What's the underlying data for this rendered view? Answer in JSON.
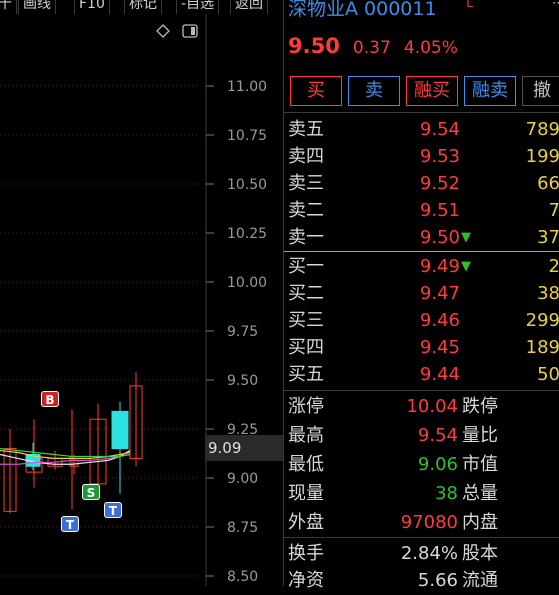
{
  "toolbar": {
    "items": [
      "十",
      "画线",
      "F10",
      "标记",
      "-自选",
      "返回"
    ]
  },
  "chart": {
    "icons": [
      "diamond-icon",
      "panel-toggle-icon"
    ],
    "y_ticks": [
      "11.00",
      "10.75",
      "10.50",
      "10.25",
      "10.00",
      "9.75",
      "9.50",
      "9.25",
      "9.00",
      "8.75",
      "8.50"
    ],
    "current_price_label": "9.09",
    "markers": [
      {
        "label": "B",
        "color": "#d42020"
      },
      {
        "label": "S",
        "color": "#1a9a30"
      },
      {
        "label": "T",
        "color": "#3a6fd8"
      },
      {
        "label": "T",
        "color": "#3a6fd8"
      }
    ],
    "colors": {
      "up": "#ff3b3b",
      "down": "#2ee0e0",
      "ma5": "#e8e8e8",
      "ma10": "#e8d040",
      "ma20": "#d050d0",
      "ma30": "#40d040"
    }
  },
  "chart_data": {
    "type": "candlestick",
    "ylim": [
      8.5,
      11.0
    ],
    "yticks": [
      11.0,
      10.75,
      10.5,
      10.25,
      10.0,
      9.75,
      9.5,
      9.25,
      9.0,
      8.75,
      8.5
    ],
    "candles": [
      {
        "open": 9.15,
        "close": 8.83,
        "high": 9.25,
        "low": 8.82,
        "dir": "up"
      },
      {
        "open": 9.1,
        "close": 9.03,
        "high": 9.3,
        "low": 8.95,
        "dir": "up"
      },
      {
        "open": 9.06,
        "close": 9.12,
        "high": 9.18,
        "low": 9.04,
        "dir": "down"
      },
      {
        "open": 9.1,
        "close": 9.06,
        "high": 9.14,
        "low": 9.04,
        "dir": "up"
      },
      {
        "open": 9.11,
        "close": 9.09,
        "high": 9.35,
        "low": 8.84,
        "dir": "up"
      },
      {
        "open": 9.06,
        "close": 9.09,
        "high": 9.12,
        "low": 9.02,
        "dir": "up"
      },
      {
        "open": 9.3,
        "close": 8.97,
        "high": 9.38,
        "low": 8.95,
        "dir": "up"
      },
      {
        "open": 9.15,
        "close": 9.34,
        "high": 9.39,
        "low": 8.92,
        "dir": "down"
      },
      {
        "open": 9.47,
        "close": 9.1,
        "high": 9.54,
        "low": 9.06,
        "dir": "up"
      }
    ],
    "ma_lines": {
      "ma5": [
        9.12,
        9.1,
        9.08,
        9.07,
        9.07,
        9.08,
        9.09,
        9.11,
        9.14
      ],
      "ma10": [
        9.14,
        9.13,
        9.11,
        9.1,
        9.1,
        9.1,
        9.11,
        9.12,
        9.13
      ],
      "ma20": [
        9.07,
        9.07,
        9.08,
        9.08,
        9.09,
        9.09,
        9.1,
        9.11,
        9.12
      ],
      "ma30": [
        9.15,
        9.14,
        9.13,
        9.12,
        9.11,
        9.11,
        9.11,
        9.11,
        9.12
      ]
    }
  },
  "stock": {
    "name": "深物业A",
    "code": "000011",
    "flag": "L",
    "price": "9.50",
    "change": "0.37",
    "change_pct": "4.05%"
  },
  "trade_buttons": [
    {
      "label": "买",
      "color": "#ff3b3b"
    },
    {
      "label": "卖",
      "color": "#3d8ee8"
    },
    {
      "label": "融买",
      "color": "#ff3b3b"
    },
    {
      "label": "融卖",
      "color": "#3d8ee8"
    },
    {
      "label": "撤",
      "color": "#c0c0c0"
    }
  ],
  "order_book": {
    "sell": [
      {
        "label": "卖五",
        "price": "9.54",
        "vol": "789"
      },
      {
        "label": "卖四",
        "price": "9.53",
        "vol": "199"
      },
      {
        "label": "卖三",
        "price": "9.52",
        "vol": "66"
      },
      {
        "label": "卖二",
        "price": "9.51",
        "vol": "7"
      },
      {
        "label": "卖一",
        "price": "9.50",
        "vol": "37",
        "arrow": "🡣"
      }
    ],
    "buy": [
      {
        "label": "买一",
        "price": "9.49",
        "vol": "2",
        "arrow": "🡣"
      },
      {
        "label": "买二",
        "price": "9.47",
        "vol": "38"
      },
      {
        "label": "买三",
        "price": "9.46",
        "vol": "299"
      },
      {
        "label": "买四",
        "price": "9.45",
        "vol": "189"
      },
      {
        "label": "买五",
        "price": "9.44",
        "vol": "50"
      }
    ]
  },
  "stats": [
    {
      "l1": "涨停",
      "v1": "10.04",
      "c1": "#ff3b3b",
      "l2": "跌停"
    },
    {
      "l1": "最高",
      "v1": "9.54",
      "c1": "#ff3b3b",
      "l2": "量比"
    },
    {
      "l1": "最低",
      "v1": "9.06",
      "c1": "#2ec02e",
      "l2": "市值"
    },
    {
      "l1": "现量",
      "v1": "38",
      "c1": "#2ec02e",
      "l2": "总量"
    },
    {
      "l1": "外盘",
      "v1": "97080",
      "c1": "#ff3b3b",
      "l2": "内盘"
    },
    {
      "l1": "换手",
      "v1": "2.84%",
      "c1": "#d8d8d8",
      "l2": "股本"
    },
    {
      "l1": "净资",
      "v1": "5.66",
      "c1": "#d8d8d8",
      "l2": "流通"
    }
  ]
}
